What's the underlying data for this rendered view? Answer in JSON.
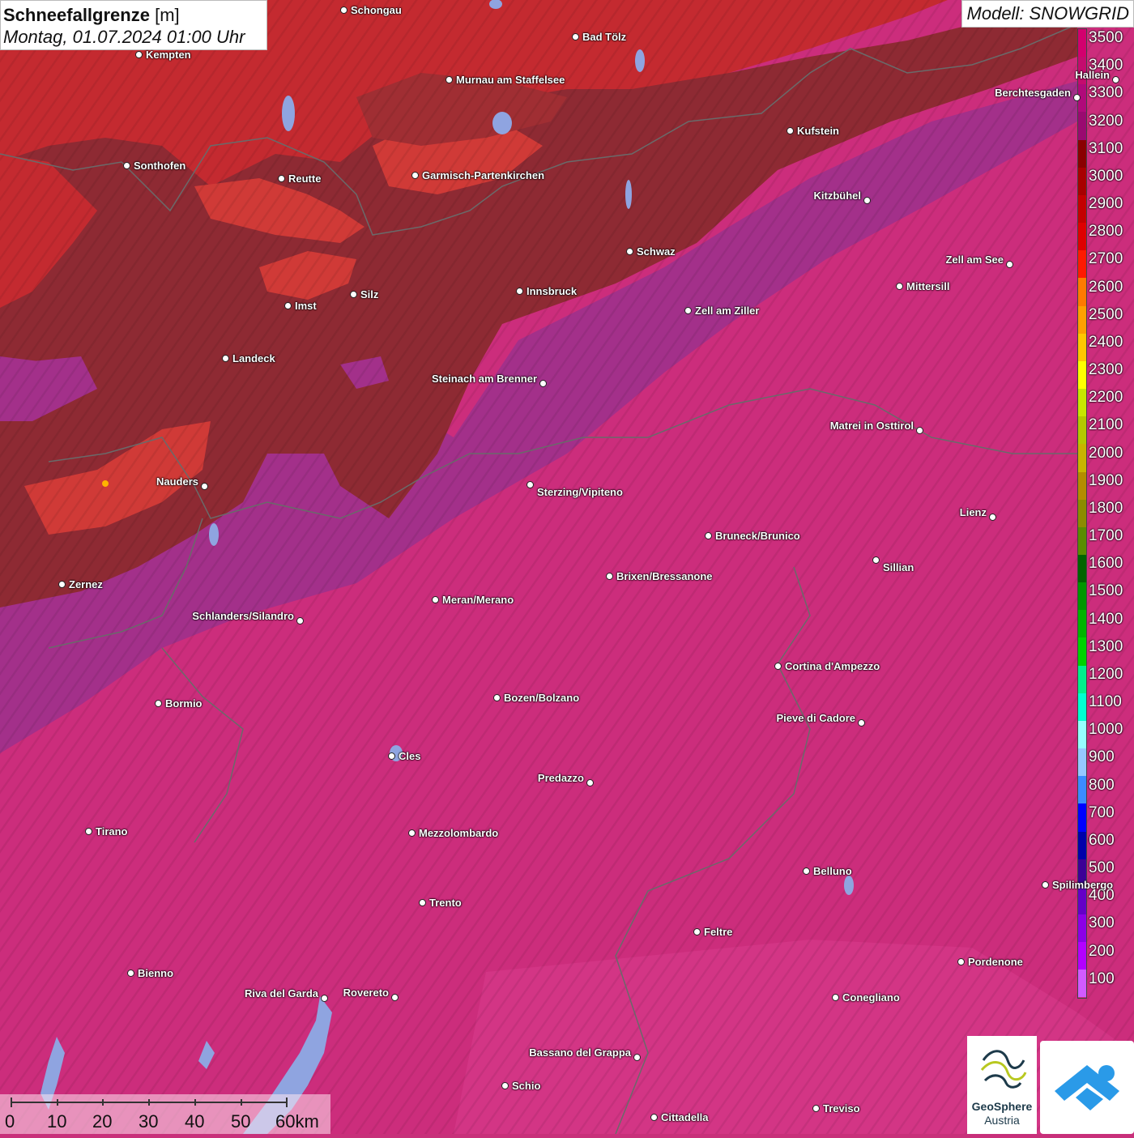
{
  "header": {
    "title_bold": "Schneefallgrenze",
    "title_unit": "[m]",
    "datetime": "Montag, 01.07.2024 01:00 Uhr"
  },
  "model": "Modell: SNOWGRID",
  "legend": {
    "labels": [
      "3500",
      "3400",
      "3300",
      "3200",
      "3100",
      "3000",
      "2900",
      "2800",
      "2700",
      "2600",
      "2500",
      "2400",
      "2300",
      "2200",
      "2100",
      "2000",
      "1900",
      "1800",
      "1700",
      "1600",
      "1500",
      "1400",
      "1300",
      "1200",
      "1100",
      "1000",
      "900",
      "800",
      "700",
      "600",
      "500",
      "400",
      "300",
      "200",
      "100"
    ],
    "colors": [
      "#d2006e",
      "#c40c6e",
      "#b00a7a",
      "#9a0a70",
      "#8a0000",
      "#a80000",
      "#c40000",
      "#de0000",
      "#ff1a00",
      "#ff7a00",
      "#ffa000",
      "#ffc800",
      "#ffff00",
      "#c8e600",
      "#b4c800",
      "#c8b400",
      "#b48c00",
      "#8c8c00",
      "#5a8c00",
      "#006400",
      "#009600",
      "#00b400",
      "#00d200",
      "#00f08c",
      "#00ffd2",
      "#96ffff",
      "#96c8ff",
      "#3c8cff",
      "#0000ff",
      "#0000aa",
      "#3c0096",
      "#6400c8",
      "#8c00e6",
      "#b400ff",
      "#d25aff"
    ]
  },
  "cities": [
    {
      "name": "Schongau"
    },
    {
      "name": "Bad Tölz"
    },
    {
      "name": "Kempten"
    },
    {
      "name": "Murnau am Staffelsee"
    },
    {
      "name": "Berchtesgaden"
    },
    {
      "name": "Kufstein"
    },
    {
      "name": "Sonthofen"
    },
    {
      "name": "Reutte"
    },
    {
      "name": "Garmisch-Partenkirchen"
    },
    {
      "name": "Kitzbühel"
    },
    {
      "name": "Schwaz"
    },
    {
      "name": "Zell am See"
    },
    {
      "name": "Mittersill"
    },
    {
      "name": "Innsbruck"
    },
    {
      "name": "Silz"
    },
    {
      "name": "Imst"
    },
    {
      "name": "Zell am Ziller"
    },
    {
      "name": "Landeck"
    },
    {
      "name": "Steinach am Brenner"
    },
    {
      "name": "Matrei in Osttirol"
    },
    {
      "name": "Nauders"
    },
    {
      "name": "Sterzing/Vipiteno"
    },
    {
      "name": "Lienz"
    },
    {
      "name": "Bruneck/Brunico"
    },
    {
      "name": "Sillian"
    },
    {
      "name": "Brixen/Bressanone"
    },
    {
      "name": "Zernez"
    },
    {
      "name": "Meran/Merano"
    },
    {
      "name": "Schlanders/Silandro"
    },
    {
      "name": "Cortina d'Ampezzo"
    },
    {
      "name": "Bozen/Bolzano"
    },
    {
      "name": "Bormio"
    },
    {
      "name": "Pieve di Cadore"
    },
    {
      "name": "Cles"
    },
    {
      "name": "Predazzo"
    },
    {
      "name": "Tirano"
    },
    {
      "name": "Mezzolombardo"
    },
    {
      "name": "Belluno"
    },
    {
      "name": "Spilimbergo"
    },
    {
      "name": "Trento"
    },
    {
      "name": "Feltre"
    },
    {
      "name": "Pordenone"
    },
    {
      "name": "Bienno"
    },
    {
      "name": "Riva del Garda"
    },
    {
      "name": "Rovereto"
    },
    {
      "name": "Conegliano"
    },
    {
      "name": "Bassano del Grappa"
    },
    {
      "name": "Schio"
    },
    {
      "name": "Treviso"
    },
    {
      "name": "Cittadella"
    },
    {
      "name": "Hallein"
    }
  ],
  "scale": {
    "labels": [
      "0",
      "10",
      "20",
      "30",
      "40",
      "50",
      "60km"
    ]
  },
  "logos": {
    "geosphere_line1": "GeoSphere",
    "geosphere_line2": "Austria"
  }
}
